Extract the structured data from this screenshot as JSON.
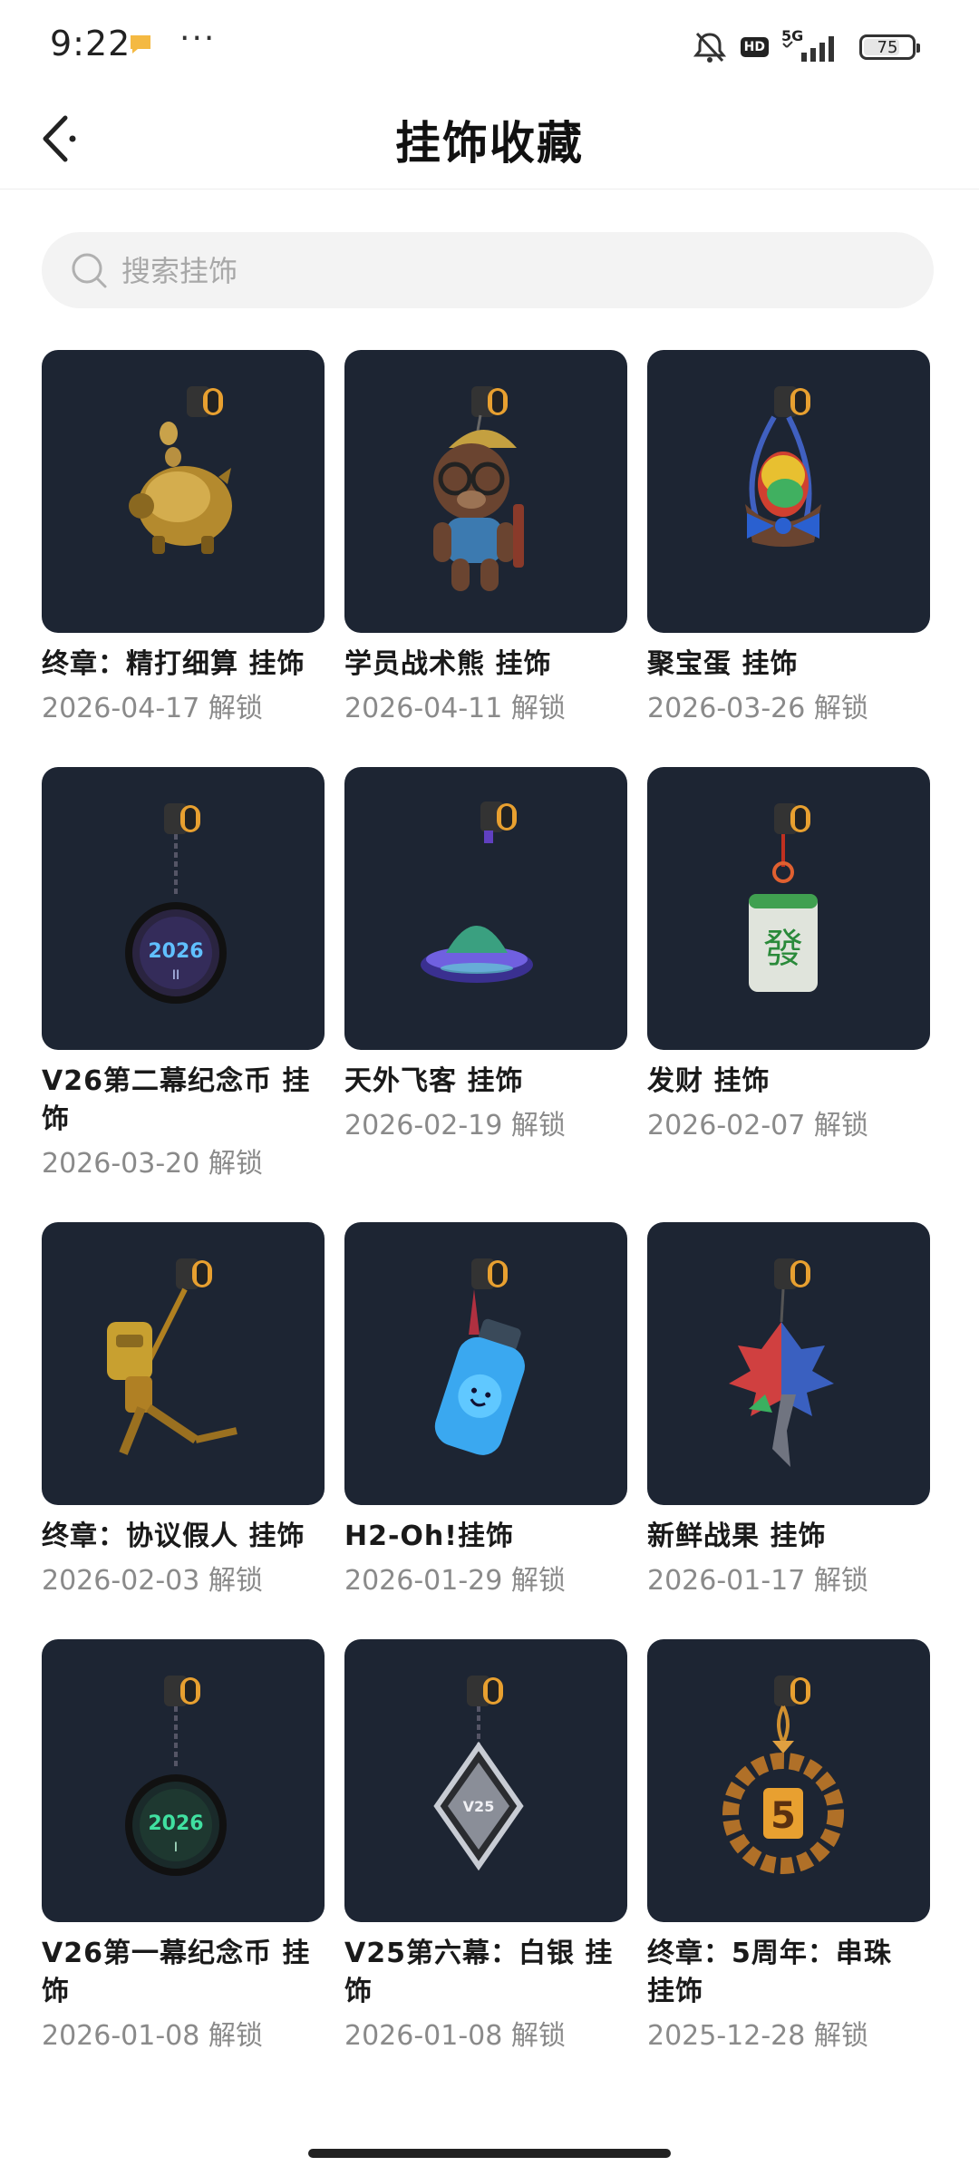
{
  "status_bar": {
    "time": "9:22",
    "more": "···",
    "network": "5G",
    "hd": "HD",
    "battery_percent": "75",
    "battery_level": 0.75
  },
  "header": {
    "title": "挂饰收藏",
    "back_icon": "back-chevron-icon"
  },
  "search": {
    "placeholder": "搜索挂饰",
    "icon": "search-icon"
  },
  "colors": {
    "card_background": "#1d2533",
    "text_primary": "#1a1a1a",
    "text_secondary": "#8a8a8a"
  },
  "charms": [
    {
      "name": "终章：精打细算 挂饰",
      "date": "2026-04-17 解锁",
      "icon": "gold-piggy-bank-charm"
    },
    {
      "name": "学员战术熊 挂饰",
      "date": "2026-04-11 解锁",
      "icon": "tactical-bear-charm"
    },
    {
      "name": "聚宝蛋 挂饰",
      "date": "2026-03-26 解锁",
      "icon": "treasure-egg-charm"
    },
    {
      "name": "V26第二幕纪念币 挂饰",
      "date": "2026-03-20 解锁",
      "icon": "v26-act2-coin-charm"
    },
    {
      "name": "天外飞客 挂饰",
      "date": "2026-02-19 解锁",
      "icon": "ufo-charm"
    },
    {
      "name": "发财 挂饰",
      "date": "2026-02-07 解锁",
      "icon": "mahjong-tile-charm"
    },
    {
      "name": "终章：协议假人 挂饰",
      "date": "2026-02-03 解锁",
      "icon": "gold-dummy-charm"
    },
    {
      "name": "H2-Oh!挂饰",
      "date": "2026-01-29 解锁",
      "icon": "water-bottle-charm"
    },
    {
      "name": "新鲜战果 挂饰",
      "date": "2026-01-17 解锁",
      "icon": "fruit-tree-charm"
    },
    {
      "name": "V26第一幕纪念币 挂饰",
      "date": "2026-01-08 解锁",
      "icon": "v26-act1-coin-charm"
    },
    {
      "name": "V25第六幕：白银 挂饰",
      "date": "2026-01-08 解锁",
      "icon": "silver-diamond-charm"
    },
    {
      "name": "终章：5周年：串珠 挂饰",
      "date": "2025-12-28 解锁",
      "icon": "five-year-bead-charm"
    }
  ]
}
